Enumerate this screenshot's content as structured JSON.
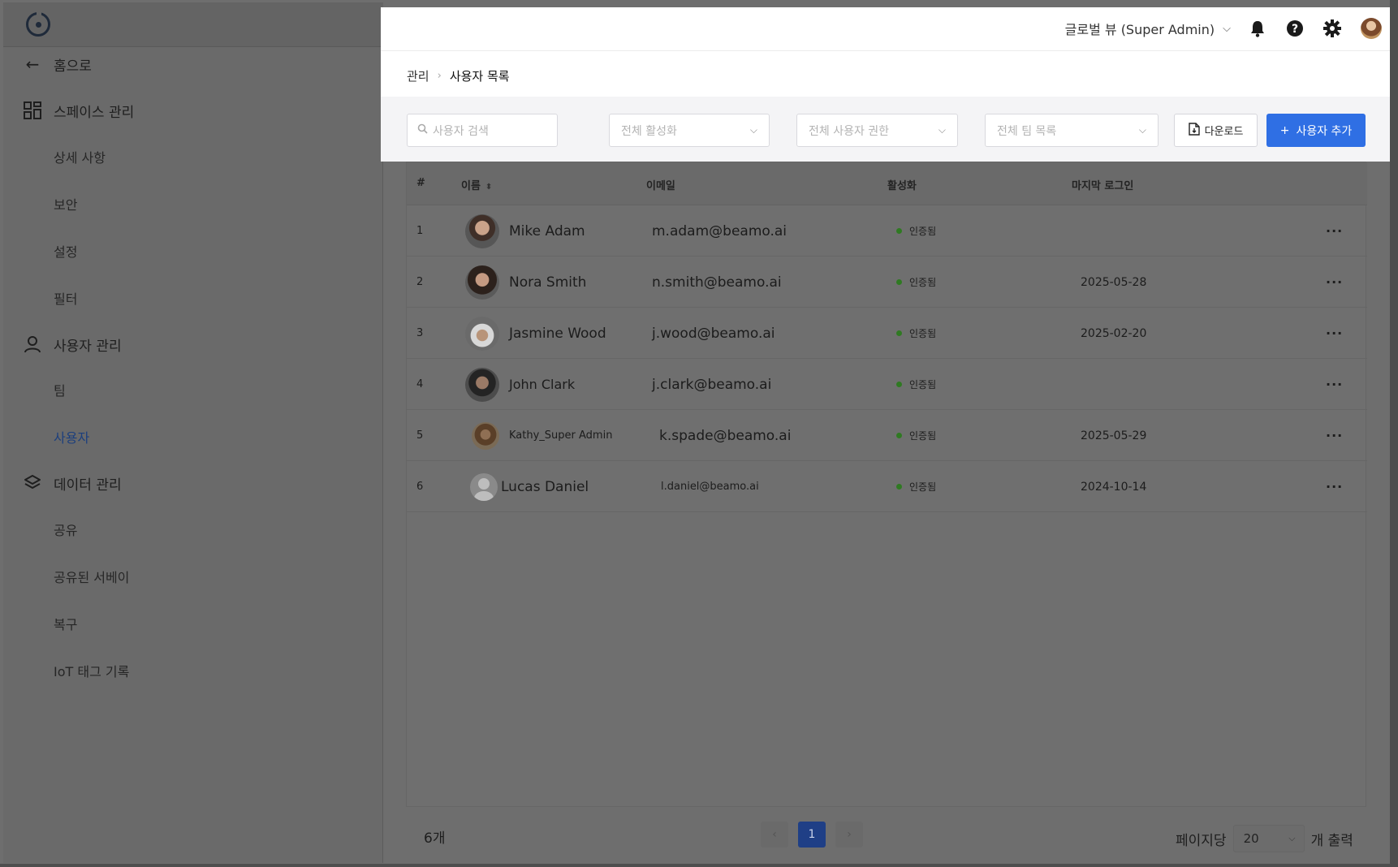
{
  "sidebar": {
    "back": "홈으로",
    "sections": [
      {
        "label": "스페이스 관리",
        "icon": "grid-icon"
      },
      {
        "label": "사용자 관리",
        "icon": "user-icon"
      },
      {
        "label": "데이터 관리",
        "icon": "layers-icon"
      }
    ],
    "space_items": [
      "상세 사항",
      "보안",
      "설정",
      "필터"
    ],
    "user_items": [
      "팀",
      "사용자"
    ],
    "data_items": [
      "공유",
      "공유된 서베이",
      "복구",
      "IoT 태그 기록"
    ]
  },
  "header": {
    "view_selector": "글로벌 뷰 (Super Admin)"
  },
  "breadcrumb": {
    "root": "관리",
    "current": "사용자 목록"
  },
  "filters": {
    "search_placeholder": "사용자 검색",
    "activation": "전체 활성화",
    "role": "전체 사용자 권한",
    "team": "전체 팀 목록",
    "download_label": "다운로드",
    "add_user_label": "사용자 추가"
  },
  "table": {
    "headers": {
      "num": "#",
      "name": "이름",
      "email": "이메일",
      "status": "활성화",
      "last_login": "마지막 로그인"
    },
    "rows": [
      {
        "num": "1",
        "name": "Mike Adam",
        "email": "m.adam@beamo.ai",
        "status": "인증됨",
        "last_login": ""
      },
      {
        "num": "2",
        "name": "Nora Smith",
        "email": "n.smith@beamo.ai",
        "status": "인증됨",
        "last_login": "2025-05-28"
      },
      {
        "num": "3",
        "name": "Jasmine Wood",
        "email": "j.wood@beamo.ai",
        "status": "인증됨",
        "last_login": "2025-02-20"
      },
      {
        "num": "4",
        "name": "John Clark",
        "email": "j.clark@beamo.ai",
        "status": "인증됨",
        "last_login": ""
      },
      {
        "num": "5",
        "name": "Kathy_Super Admin",
        "email": "k.spade@beamo.ai",
        "status": "인증됨",
        "last_login": "2025-05-29"
      },
      {
        "num": "6",
        "name": "Lucas Daniel",
        "email": "l.daniel@beamo.ai",
        "status": "인증됨",
        "last_login": "2024-10-14"
      }
    ],
    "more": "···"
  },
  "footer": {
    "total": "6개",
    "current_page": "1",
    "per_page_label": "페이지당",
    "per_page_value": "20",
    "per_page_suffix": "개 출력"
  },
  "colors": {
    "accent": "#2f6fe4",
    "status_dot": "#2f7a22"
  }
}
